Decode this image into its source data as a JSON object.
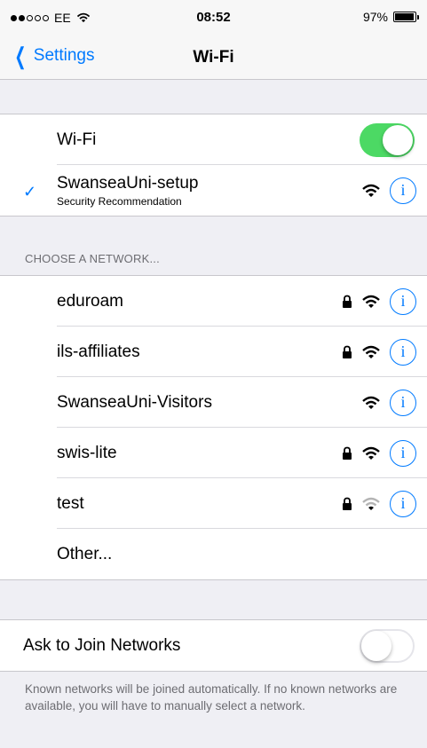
{
  "status_bar": {
    "carrier": "EE",
    "time": "08:52",
    "battery": "97%",
    "battery_level": 0.97
  },
  "nav": {
    "back_label": "Settings",
    "title": "Wi-Fi"
  },
  "wifi_toggle": {
    "label": "Wi-Fi",
    "state": "on"
  },
  "connected": {
    "name": "SwanseaUni-setup",
    "subtitle": "Security Recommendation",
    "checkmark": "✓"
  },
  "networks_header": "CHOOSE A NETWORK...",
  "networks": [
    {
      "name": "eduroam",
      "locked": true,
      "signal": "full"
    },
    {
      "name": "ils-affiliates",
      "locked": true,
      "signal": "full"
    },
    {
      "name": "SwanseaUni-Visitors",
      "locked": false,
      "signal": "full"
    },
    {
      "name": "swis-lite",
      "locked": true,
      "signal": "full"
    },
    {
      "name": "test",
      "locked": true,
      "signal": "weak"
    }
  ],
  "other_label": "Other...",
  "ask_to_join": {
    "label": "Ask to Join Networks",
    "state": "off"
  },
  "footer": "Known networks will be joined automatically. If no known networks are available, you will have to manually select a network.",
  "info_glyph": "i",
  "colors": {
    "accent": "#007aff",
    "toggle_on": "#4cd964",
    "background": "#efeff4"
  }
}
